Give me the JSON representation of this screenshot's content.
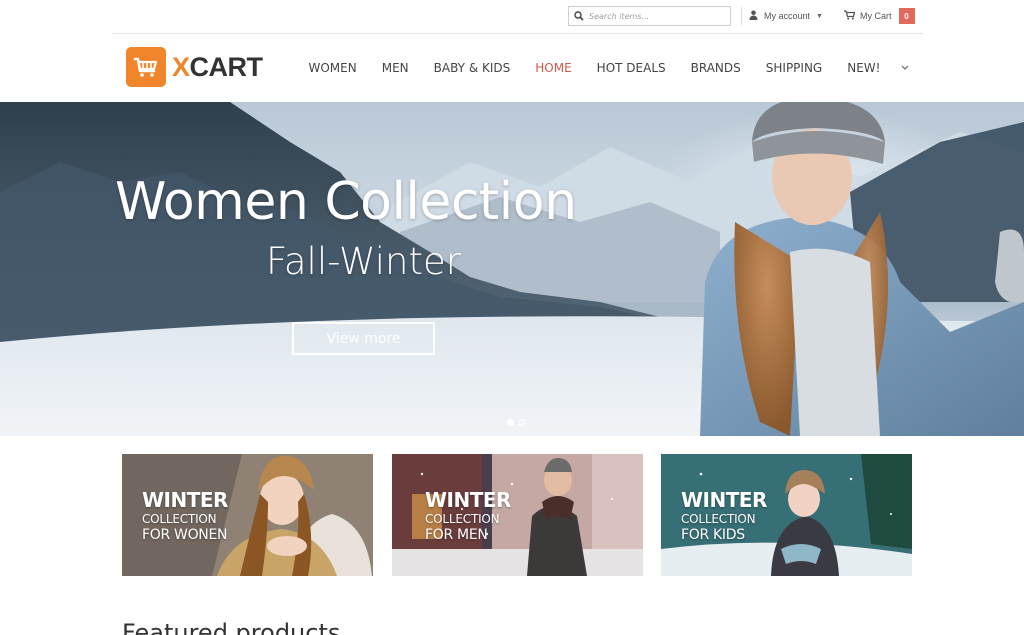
{
  "topbar": {
    "search_placeholder": "Search items...",
    "account_label": "My account",
    "cart_label": "My Cart",
    "cart_count": "0"
  },
  "logo": {
    "x": "X",
    "rest": "CART"
  },
  "nav": {
    "items": [
      "WOMEN",
      "MEN",
      "BABY & KIDS",
      "HOME",
      "HOT DEALS",
      "BRANDS",
      "SHIPPING",
      "NEW!"
    ],
    "active": "HOME"
  },
  "hero": {
    "title": "Women Collection",
    "subtitle": "Fall-Winter",
    "button": "View more",
    "slides": 2,
    "active_slide": 1
  },
  "banners": [
    {
      "line1": "WINTER",
      "line2": "COLLECTION",
      "line3": "FOR WONEN"
    },
    {
      "line1": "WINTER",
      "line2": "COLLECTION",
      "line3": "FOR MEN"
    },
    {
      "line1": "WINTER",
      "line2": "COLLECTION",
      "line3": "FOR KIDS"
    }
  ],
  "featured_title": "Featured products",
  "colors": {
    "accent": "#f0852b",
    "active_nav": "#d05a4b",
    "badge": "#e26a5a"
  }
}
